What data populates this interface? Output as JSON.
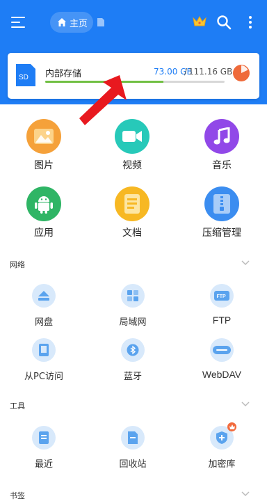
{
  "header": {
    "home_label": "主页",
    "icons": [
      "menu-icon",
      "home-icon",
      "document-icon",
      "crown-icon",
      "search-icon",
      "more-vertical-icon"
    ]
  },
  "storage": {
    "name": "内部存储",
    "sd_label": "SD",
    "used": "73.00 GB",
    "separator": "/",
    "total": "111.16 GB",
    "used_fraction": 0.66
  },
  "categories": [
    {
      "label": "图片",
      "icon": "picture-icon",
      "color": "#f5a13a"
    },
    {
      "label": "视频",
      "icon": "video-icon",
      "color": "#27c9b9"
    },
    {
      "label": "音乐",
      "icon": "music-icon",
      "color": "#9148e8"
    },
    {
      "label": "应用",
      "icon": "android-icon",
      "color": "#2fb565"
    },
    {
      "label": "文档",
      "icon": "document-icon",
      "color": "#f7b823"
    },
    {
      "label": "压缩管理",
      "icon": "archive-icon",
      "color": "#3b8df0"
    }
  ],
  "sections": {
    "network": {
      "title": "网络",
      "items": [
        {
          "label": "网盘",
          "icon": "cloud-drive-icon"
        },
        {
          "label": "局域网",
          "icon": "lan-icon"
        },
        {
          "label": "FTP",
          "icon": "ftp-icon"
        },
        {
          "label": "从PC访问",
          "icon": "pc-access-icon"
        },
        {
          "label": "蓝牙",
          "icon": "bluetooth-icon"
        },
        {
          "label": "WebDAV",
          "icon": "webdav-icon"
        }
      ]
    },
    "tools": {
      "title": "工具",
      "items": [
        {
          "label": "最近",
          "icon": "recent-icon"
        },
        {
          "label": "回收站",
          "icon": "recycle-bin-icon"
        },
        {
          "label": "加密库",
          "icon": "vault-icon",
          "has_crown_badge": true
        }
      ]
    },
    "bookmarks": {
      "title": "书签"
    }
  },
  "colors": {
    "brand_blue": "#1e7df5",
    "progress_green": "#71c043",
    "arrow_red": "#e8191f",
    "pie_orange": "#ef6a3a",
    "tool_circle": "#d8e9fb",
    "tool_icon_blue": "#5aa3ee"
  }
}
